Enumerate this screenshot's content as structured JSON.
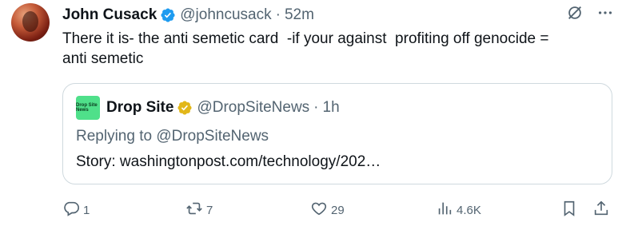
{
  "author": {
    "name": "John Cusack",
    "handle": "@johncusack",
    "time": "52m"
  },
  "text": "There it is- the anti semetic card  -if your against  profiting off genocide =\nanti semetic",
  "quote": {
    "logo_text": "Drop Site News",
    "name": "Drop Site",
    "handle": "@DropSiteNews",
    "time": "1h",
    "reply": "Replying to @DropSiteNews",
    "story": "Story: washingtonpost.com/technology/202…"
  },
  "actions": {
    "replies": "1",
    "reposts": "7",
    "likes": "29",
    "views": "4.6K"
  },
  "colors": {
    "verified_blue": "#1d9bf0",
    "verified_gold": "#e2b719",
    "secondary_text": "#536471",
    "border": "#cfd9de",
    "logo_green": "#4fe08a"
  }
}
